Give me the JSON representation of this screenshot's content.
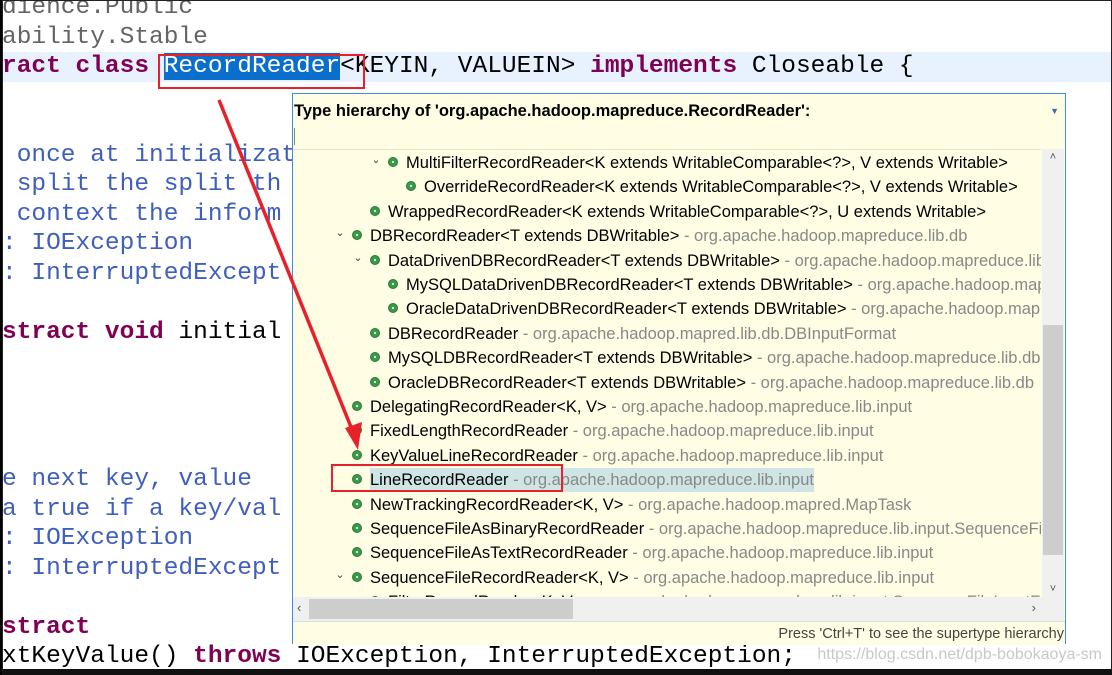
{
  "editor": {
    "lines": [
      [
        {
          "t": "dience.",
          "c": "ann"
        },
        {
          "t": "Public",
          "c": "ann"
        }
      ],
      [
        {
          "t": "ability.Stable",
          "c": "ann"
        }
      ],
      [
        {
          "t": "ract ",
          "c": "kw"
        },
        {
          "t": "class ",
          "c": "kw"
        },
        {
          "t": "RecordReader",
          "c": "sel"
        },
        {
          "t": "<KEYIN, VALUEIN> ",
          "c": "pl"
        },
        {
          "t": "implements ",
          "c": "kw"
        },
        {
          "t": "Closeable {",
          "c": "pl"
        }
      ],
      [],
      [],
      [
        {
          "t": " once at initialization",
          "c": "cm"
        }
      ],
      [
        {
          "t": " split the split th",
          "c": "cm"
        }
      ],
      [
        {
          "t": " context the inform",
          "c": "cm"
        }
      ],
      [
        {
          "t": ": IOException",
          "c": "cm"
        }
      ],
      [
        {
          "t": ": InterruptedExcept",
          "c": "cm"
        }
      ],
      [],
      [
        {
          "t": "stract ",
          "c": "kw"
        },
        {
          "t": "void ",
          "c": "kw"
        },
        {
          "t": "initial",
          "c": "pl"
        }
      ],
      [],
      [],
      [],
      [],
      [
        {
          "t": "e next key, value",
          "c": "cm"
        }
      ],
      [
        {
          "t": "a true if a key/val",
          "c": "cm"
        }
      ],
      [
        {
          "t": ": IOException",
          "c": "cm"
        }
      ],
      [
        {
          "t": ": InterruptedExcept",
          "c": "cm"
        }
      ],
      [],
      [
        {
          "t": "stract",
          "c": "kw"
        }
      ],
      [
        {
          "t": "xtKeyValue() ",
          "c": "pl"
        },
        {
          "t": "throws ",
          "c": "kw"
        },
        {
          "t": "IOException, InterruptedException;",
          "c": "pl"
        }
      ]
    ],
    "current_line": 2
  },
  "popup": {
    "title": "Type hierarchy of 'org.apache.hadoop.mapreduce.RecordReader':",
    "footer": "Press 'Ctrl+T' to see the supertype hierarchy",
    "vscroll_up": "˄",
    "vscroll_down": "˅",
    "hscroll_left": "‹",
    "hscroll_right": "›",
    "items": [
      {
        "level": 2,
        "expanded": true,
        "name": "MultiFilterRecordReader<K extends WritableComparable<?>, V extends Writable>",
        "pkg": ""
      },
      {
        "level": 3,
        "name": "OverrideRecordReader<K extends WritableComparable<?>, V extends Writable>",
        "pkg": ""
      },
      {
        "level": 1,
        "name": "WrappedRecordReader<K extends WritableComparable<?>, U extends Writable>",
        "pkg": ""
      },
      {
        "level": 0,
        "expanded": true,
        "name": "DBRecordReader<T extends DBWritable>",
        "pkg": " - org.apache.hadoop.mapreduce.lib.db"
      },
      {
        "level": 1,
        "expanded": true,
        "name": "DataDrivenDBRecordReader<T extends DBWritable>",
        "pkg": " - org.apache.hadoop.mapreduce.lib.db"
      },
      {
        "level": 2,
        "name": "MySQLDataDrivenDBRecordReader<T extends DBWritable>",
        "pkg": " - org.apache.hadoop.mapreduce.lib.db"
      },
      {
        "level": 2,
        "name": "OracleDataDrivenDBRecordReader<T extends DBWritable>",
        "pkg": " - org.apache.hadoop.mapreduce.lib.db"
      },
      {
        "level": 1,
        "name": "DBRecordReader",
        "pkg": " - org.apache.hadoop.mapred.lib.db.DBInputFormat"
      },
      {
        "level": 1,
        "name": "MySQLDBRecordReader<T extends DBWritable>",
        "pkg": " - org.apache.hadoop.mapreduce.lib.db"
      },
      {
        "level": 1,
        "name": "OracleDBRecordReader<T extends DBWritable>",
        "pkg": " - org.apache.hadoop.mapreduce.lib.db"
      },
      {
        "level": 0,
        "name": "DelegatingRecordReader<K, V>",
        "pkg": " - org.apache.hadoop.mapreduce.lib.input"
      },
      {
        "level": 0,
        "name": "FixedLengthRecordReader",
        "pkg": " - org.apache.hadoop.mapreduce.lib.input"
      },
      {
        "level": 0,
        "name": "KeyValueLineRecordReader",
        "pkg": " - org.apache.hadoop.mapreduce.lib.input"
      },
      {
        "level": 0,
        "name": "LineRecordReader",
        "pkg": " - org.apache.hadoop.mapreduce.lib.input",
        "selected": true
      },
      {
        "level": 0,
        "name": "NewTrackingRecordReader<K, V>",
        "pkg": " - org.apache.hadoop.mapred.MapTask"
      },
      {
        "level": 0,
        "name": "SequenceFileAsBinaryRecordReader",
        "pkg": " - org.apache.hadoop.mapreduce.lib.input.SequenceFileAsBinaryInputFormat"
      },
      {
        "level": 0,
        "name": "SequenceFileAsTextRecordReader",
        "pkg": " - org.apache.hadoop.mapreduce.lib.input"
      },
      {
        "level": 0,
        "expanded": true,
        "name": "SequenceFileRecordReader<K, V>",
        "pkg": " - org.apache.hadoop.mapreduce.lib.input"
      },
      {
        "level": 1,
        "name": "FilterRecordReader<K, V>",
        "pkg": " - org.apache.hadoop.mapreduce.lib.input.SequenceFileInputFilter"
      }
    ]
  },
  "watermark": "https://blog.csdn.net/dpb-bobokaoya-sm",
  "colors": {
    "annotation_red": "#e8202a",
    "selection": "#0a6fcc",
    "keyword": "#7f0055",
    "comment": "#3f5fbf",
    "popup_bg": "#fffee4",
    "class_icon": "#3a9a4a"
  }
}
